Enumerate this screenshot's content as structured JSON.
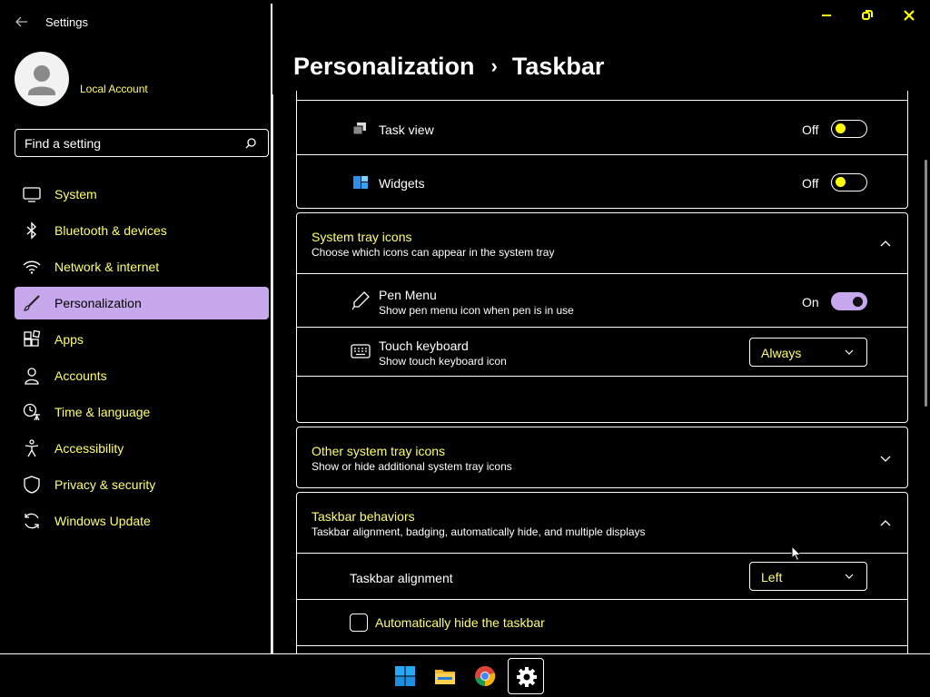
{
  "window": {
    "title": "Settings"
  },
  "account": {
    "name": "Local Account"
  },
  "search": {
    "placeholder": "Find a setting"
  },
  "sidebar": {
    "items": [
      {
        "label": "System",
        "icon": "monitor-icon"
      },
      {
        "label": "Bluetooth & devices",
        "icon": "bluetooth-icon"
      },
      {
        "label": "Network & internet",
        "icon": "wifi-icon"
      },
      {
        "label": "Personalization",
        "icon": "brush-icon",
        "active": true
      },
      {
        "label": "Apps",
        "icon": "apps-icon"
      },
      {
        "label": "Accounts",
        "icon": "person-icon"
      },
      {
        "label": "Time & language",
        "icon": "clock-globe-icon"
      },
      {
        "label": "Accessibility",
        "icon": "accessibility-icon"
      },
      {
        "label": "Privacy & security",
        "icon": "shield-icon"
      },
      {
        "label": "Windows Update",
        "icon": "update-icon"
      }
    ]
  },
  "breadcrumb": {
    "parent": "Personalization",
    "separator": "›",
    "current": "Taskbar"
  },
  "taskbar_items": {
    "task_view": {
      "label": "Task view",
      "state": "Off",
      "on": false
    },
    "widgets": {
      "label": "Widgets",
      "state": "Off",
      "on": false
    }
  },
  "system_tray": {
    "title": "System tray icons",
    "subtitle": "Choose which icons can appear in the system tray",
    "pen_menu": {
      "label": "Pen Menu",
      "subtitle": "Show pen menu icon when pen is in use",
      "state": "On",
      "on": true
    },
    "touch_keyboard": {
      "label": "Touch keyboard",
      "subtitle": "Show touch keyboard icon",
      "value": "Always"
    }
  },
  "other_tray": {
    "title": "Other system tray icons",
    "subtitle": "Show or hide additional system tray icons"
  },
  "behaviors": {
    "title": "Taskbar behaviors",
    "subtitle": "Taskbar alignment, badging, automatically hide, and multiple displays",
    "alignment": {
      "label": "Taskbar alignment",
      "value": "Left"
    },
    "auto_hide": {
      "label": "Automatically hide the taskbar",
      "checked": false
    }
  },
  "colors": {
    "accent": "#c8a8ec",
    "highlight_text": "#ffff6e",
    "background": "#000000"
  }
}
